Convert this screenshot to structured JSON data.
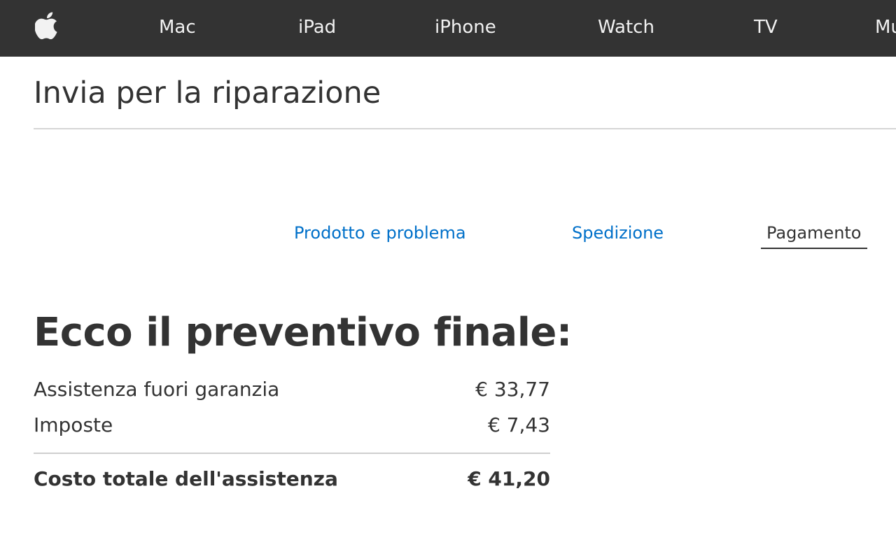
{
  "nav": {
    "logo_icon": "apple-logo-icon",
    "items": [
      {
        "label": "Mac"
      },
      {
        "label": "iPad"
      },
      {
        "label": "iPhone"
      },
      {
        "label": "Watch"
      },
      {
        "label": "TV"
      },
      {
        "label": "Mu"
      }
    ]
  },
  "page": {
    "title": "Invia per la riparazione"
  },
  "steps": [
    {
      "label": "Prodotto e problema",
      "state": "completed"
    },
    {
      "label": "Spedizione",
      "state": "completed"
    },
    {
      "label": "Pagamento",
      "state": "current"
    }
  ],
  "quote": {
    "heading": "Ecco il preventivo finale:",
    "lines": [
      {
        "label": "Assistenza fuori garanzia",
        "value": "€ 33,77"
      },
      {
        "label": "Imposte",
        "value": "€ 7,43"
      }
    ],
    "total": {
      "label": "Costo totale dell'assistenza",
      "value": "€ 41,20"
    }
  },
  "colors": {
    "nav_background": "#333333",
    "link": "#0070c9",
    "text": "#333333"
  }
}
